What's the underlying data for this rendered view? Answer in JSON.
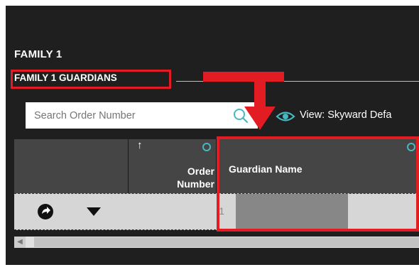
{
  "family": {
    "title": "FAMILY 1",
    "section_title": "FAMILY 1 GUARDIANS"
  },
  "search": {
    "placeholder": "Search Order Number",
    "value": ""
  },
  "view": {
    "label": "View: Skyward Defa"
  },
  "grid": {
    "columns": [
      {
        "label": "",
        "key": "actions"
      },
      {
        "label": "Order Number",
        "key": "order",
        "sorted": "ascending"
      },
      {
        "label": "Guardian Name",
        "key": "guardian_name"
      }
    ],
    "rows": [
      {
        "order_number": "1",
        "guardian_name": ""
      }
    ]
  },
  "colors": {
    "panel_background": "#1f1f1f",
    "header_background": "#454545",
    "row_background": "#d6d6d6",
    "settings_icon": "#46b9c2",
    "annotation_red": "#e31b23"
  },
  "icons": {
    "search": "search-icon",
    "view": "eye-icon",
    "sort": "sort-ascending-arrow-icon",
    "column_settings": "gear-icon",
    "open_record": "arrow-circle-right-icon",
    "expand": "caret-down-icon"
  }
}
